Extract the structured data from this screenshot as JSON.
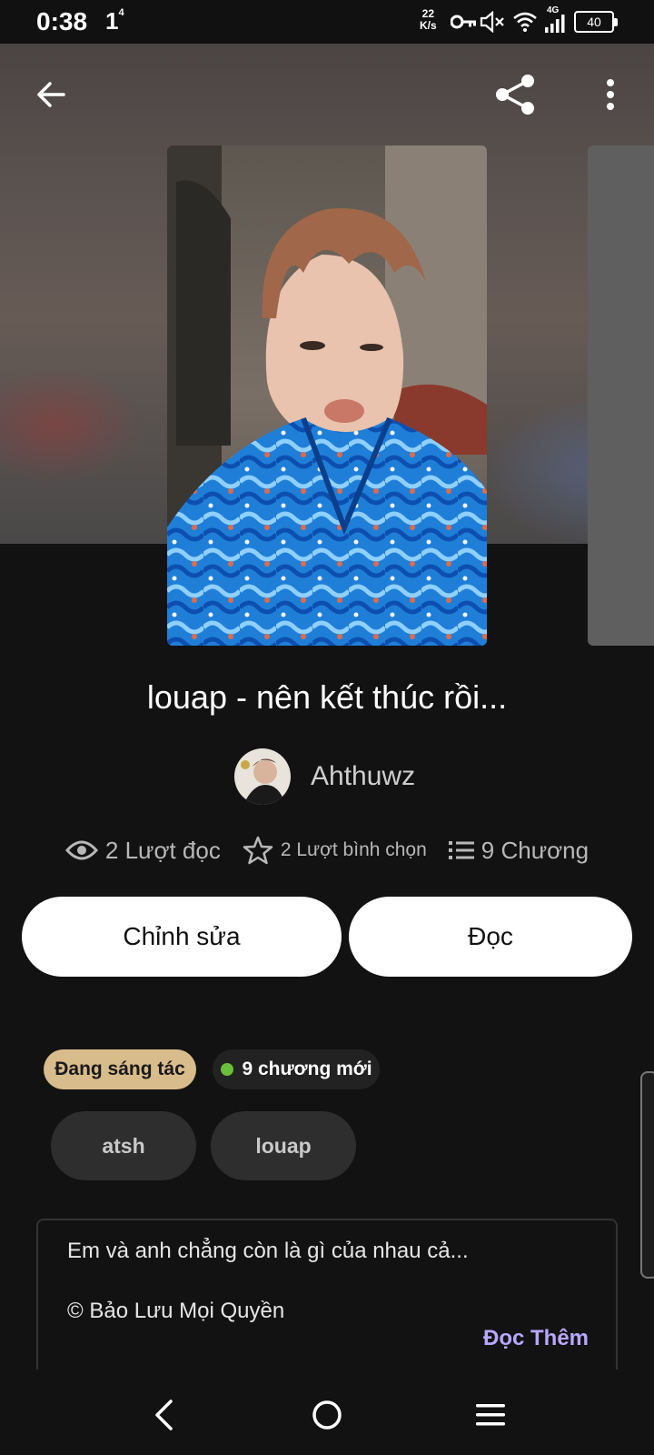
{
  "status_bar": {
    "time": "0:38",
    "notification_glyph": "1",
    "notification_sup": "4",
    "net_speed_value": "22",
    "net_speed_unit": "K/s",
    "network_type": "4G",
    "battery": "40"
  },
  "story": {
    "title": "louap - nên kết thúc rồi...",
    "author": "Ahthuwz",
    "reads": "2 Lượt đọc",
    "votes": "2 Lượt bình chọn",
    "chapters": "9 Chương"
  },
  "actions": {
    "edit_label": "Chỉnh sửa",
    "read_label": "Đọc"
  },
  "status_chips": {
    "status": "Đang sáng tác",
    "new_chapters": "9 chương mới"
  },
  "tags": [
    "atsh",
    "louap"
  ],
  "description": {
    "line1": "Em và anh chẳng còn là gì của nhau cả...",
    "line2": "© Bảo Lưu Mọi Quyền",
    "read_more": "Đọc Thêm"
  },
  "icons": {
    "back": "arrow-left-icon",
    "share": "share-icon",
    "menu": "more-vertical-icon",
    "reads": "eye-icon",
    "votes": "star-icon",
    "chapters": "list-icon"
  },
  "colors": {
    "background": "#121212",
    "button_bg": "#ffffff",
    "status_chip_bg": "#d9bc8c",
    "new_chip_bg": "#222222",
    "new_dot": "#6bbf3a",
    "read_more": "#b7a7ff",
    "tag_bg": "#2e2e2e"
  }
}
